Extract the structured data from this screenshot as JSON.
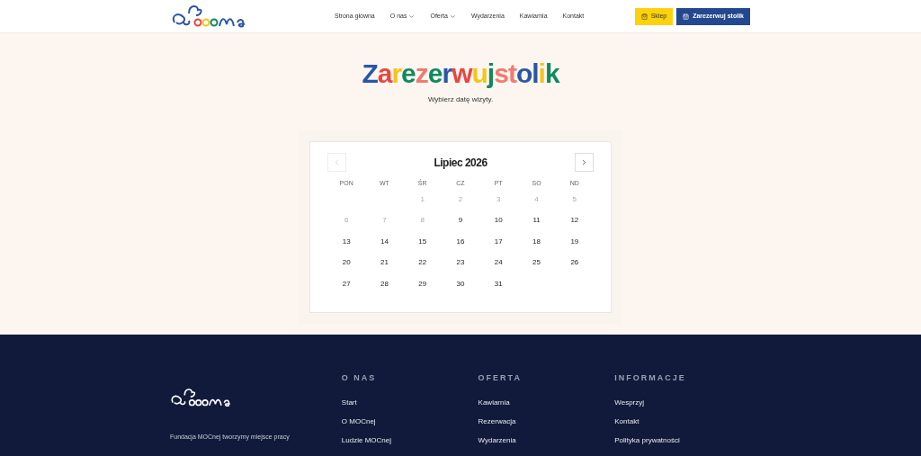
{
  "nav": {
    "items": [
      {
        "label": "Strona główna",
        "dropdown": false
      },
      {
        "label": "O nas",
        "dropdown": true
      },
      {
        "label": "Oferta",
        "dropdown": true
      },
      {
        "label": "Wydarzenia",
        "dropdown": false
      },
      {
        "label": "Kawiarnia",
        "dropdown": false
      },
      {
        "label": "Kontakt",
        "dropdown": false
      }
    ],
    "buttons": [
      {
        "label": "Sklep",
        "kind": "shop"
      },
      {
        "label": "Zarezerwuj stolik",
        "kind": "reserve"
      }
    ]
  },
  "hero": {
    "title": "Zarezerwujstolik",
    "subtitle": "Wybierz datę wizyty."
  },
  "calendar": {
    "month": "Lipiec 2026",
    "prev_disabled": true,
    "weekdays": [
      "PON",
      "WT",
      "ŚR",
      "CZ",
      "PT",
      "SO",
      "ND"
    ],
    "weeks": [
      [
        {
          "label": "1",
          "disabled": true
        },
        {
          "label": "2",
          "disabled": true
        },
        {
          "label": "3",
          "disabled": true
        },
        {
          "label": "4",
          "disabled": true
        },
        {
          "label": "5",
          "disabled": true
        }
      ],
      [
        {
          "label": "6",
          "disabled": true
        },
        {
          "label": "7",
          "disabled": true
        },
        {
          "label": "8",
          "disabled": true
        },
        {
          "label": "9",
          "disabled": false
        },
        {
          "label": "10",
          "disabled": false
        },
        {
          "label": "11",
          "disabled": false
        },
        {
          "label": "12",
          "disabled": false
        }
      ],
      [
        {
          "label": "13",
          "disabled": false
        },
        {
          "label": "14",
          "disabled": false
        },
        {
          "label": "15",
          "disabled": false
        },
        {
          "label": "16",
          "disabled": false
        },
        {
          "label": "17",
          "disabled": false
        },
        {
          "label": "18",
          "disabled": false
        },
        {
          "label": "19",
          "disabled": false
        }
      ],
      [
        {
          "label": "20",
          "disabled": false
        },
        {
          "label": "21",
          "disabled": false
        },
        {
          "label": "22",
          "disabled": false
        },
        {
          "label": "23",
          "disabled": false
        },
        {
          "label": "24",
          "disabled": false
        },
        {
          "label": "25",
          "disabled": false
        },
        {
          "label": "26",
          "disabled": false
        }
      ],
      [
        {
          "label": "27",
          "disabled": false
        },
        {
          "label": "28",
          "disabled": false
        },
        {
          "label": "29",
          "disabled": false
        },
        {
          "label": "30",
          "disabled": false
        },
        {
          "label": "31",
          "disabled": false
        }
      ]
    ]
  },
  "footer": {
    "tagline": "Fundacja MOCnej tworzymy miejsce pracy",
    "columns": [
      {
        "heading": "O NAS",
        "links": [
          "Start",
          "O MOCnej",
          "Ludzie MOCnej"
        ]
      },
      {
        "heading": "OFERTA",
        "links": [
          "Kawiarnia",
          "Rezerwacja",
          "Wydarzenia"
        ]
      },
      {
        "heading": "INFORMACJE",
        "links": [
          "Wesprzyj",
          "Kontakt",
          "Polityka prywatności"
        ]
      }
    ]
  }
}
